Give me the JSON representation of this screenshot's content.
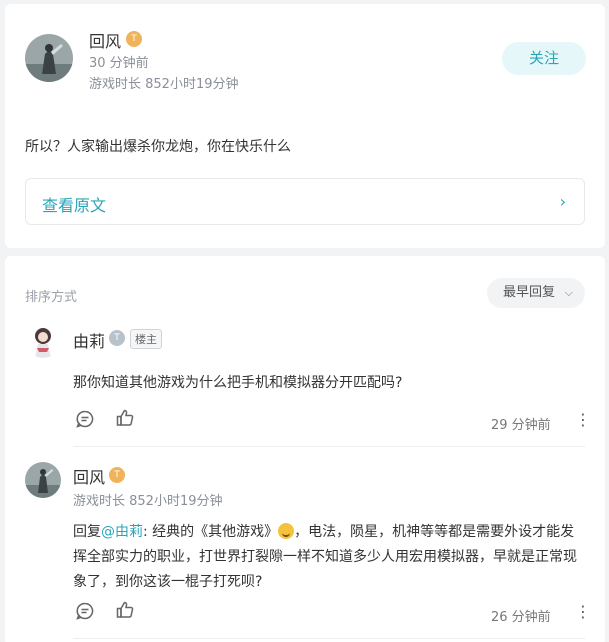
{
  "post": {
    "author": "回风",
    "level_badge": "T",
    "time_ago": "30 分钟前",
    "playtime": "游戏时长 852小时19分钟",
    "follow_label": "关注",
    "text": "所以？人家输出爆杀你龙炮，你在快乐什么",
    "view_original": "查看原文",
    "view_original_icon": "chevron-right-icon"
  },
  "comments_header": {
    "sort_label": "排序方式",
    "sort_value": "最早回复"
  },
  "comments": [
    {
      "author": "由莉",
      "level_badge": "T",
      "owner_tag": "楼主",
      "text": "那你知道其他游戏为什么把手机和模拟器分开匹配吗?",
      "time_ago": "29 分钟前"
    },
    {
      "author": "回风",
      "level_badge": "T",
      "playtime": "游戏时长 852小时19分钟",
      "reply_prefix": "回复",
      "mention": "@由莉",
      "text_line1": ": 经典的《其他游戏》",
      "text_line1b": "，电法，陨星，机神等等都是需要外设才能发",
      "text_line2": "挥全部实力的职业，打世界打裂隙一样不知道多少人用宏用模拟器，早就是正常现",
      "text_line3": "象了，到你这该一棍子打死呗?",
      "time_ago": "26 分钟前"
    }
  ],
  "colors": {
    "accent": "#2aa5b8",
    "badge_orange": "#f0b35a",
    "badge_gray": "#b8c2cc"
  }
}
